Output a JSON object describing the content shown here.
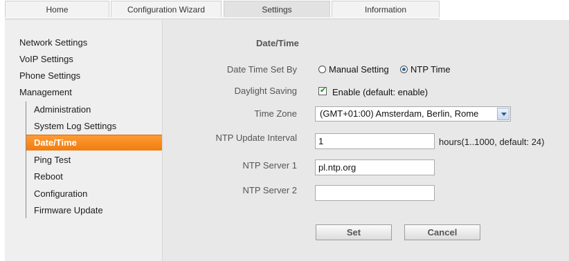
{
  "tabs": [
    {
      "label": "Home"
    },
    {
      "label": "Configuration Wizard"
    },
    {
      "label": "Settings"
    },
    {
      "label": "Information"
    }
  ],
  "sidebar": {
    "top_items": [
      {
        "label": "Network Settings"
      },
      {
        "label": "VoIP Settings"
      },
      {
        "label": "Phone Settings"
      },
      {
        "label": "Management"
      }
    ],
    "sub_items": [
      {
        "label": "Administration"
      },
      {
        "label": "System Log Settings"
      },
      {
        "label": "Date/Time"
      },
      {
        "label": "Ping Test"
      },
      {
        "label": "Reboot"
      },
      {
        "label": "Configuration"
      },
      {
        "label": "Firmware Update"
      }
    ]
  },
  "main": {
    "title": "Date/Time",
    "date_time_set_by": {
      "label": "Date Time Set By",
      "options": [
        "Manual Setting",
        "NTP Time"
      ],
      "selected": "NTP Time"
    },
    "daylight_saving": {
      "label": "Daylight Saving",
      "checkbox_label": "Enable (default: enable)",
      "checked": true
    },
    "time_zone": {
      "label": "Time Zone",
      "value": "(GMT+01:00) Amsterdam, Berlin, Rome"
    },
    "ntp_update_interval": {
      "label": "NTP Update Interval",
      "value": "1",
      "hint": "hours(1..1000, default: 24)"
    },
    "ntp_server_1": {
      "label": "NTP Server 1",
      "value": "pl.ntp.org"
    },
    "ntp_server_2": {
      "label": "NTP Server 2",
      "value": ""
    },
    "buttons": {
      "set": "Set",
      "cancel": "Cancel"
    }
  },
  "colors": {
    "accent": "#f08a1e",
    "sidebar_bg": "#efefef",
    "main_bg": "#e8e8e8"
  }
}
